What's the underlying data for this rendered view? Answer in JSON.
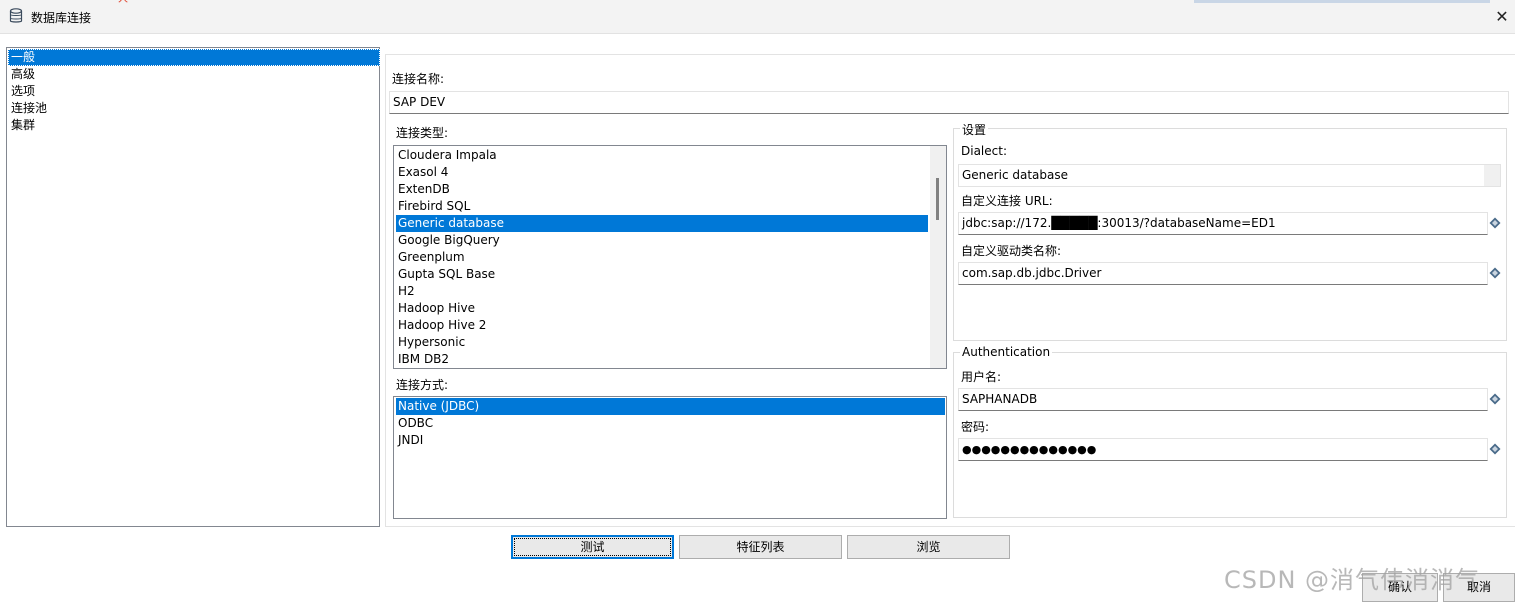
{
  "window": {
    "title": "数据库连接",
    "close_glyph": "✕",
    "red_mark": "人"
  },
  "nav": {
    "items": [
      "一般",
      "高级",
      "选项",
      "连接池",
      "集群"
    ],
    "selected": 0
  },
  "connection_name": {
    "label": "连接名称:",
    "value": "SAP DEV"
  },
  "connection_type": {
    "label": "连接类型:",
    "items": [
      "Cloudera Impala",
      "Exasol 4",
      "ExtenDB",
      "Firebird SQL",
      "Generic database",
      "Google BigQuery",
      "Greenplum",
      "Gupta SQL Base",
      "H2",
      "Hadoop Hive",
      "Hadoop Hive 2",
      "Hypersonic",
      "IBM DB2"
    ],
    "selected": 4
  },
  "access_method": {
    "label": "连接方式:",
    "items": [
      "Native (JDBC)",
      "ODBC",
      "JNDI"
    ],
    "selected": 0
  },
  "settings": {
    "legend": "设置",
    "dialect_label": "Dialect:",
    "dialect_value": "Generic database",
    "custom_url_label": "自定义连接 URL:",
    "custom_url_value": "jdbc:sap://172.█████:30013/?databaseName=ED1",
    "driver_label": "自定义驱动类名称:",
    "driver_value": "com.sap.db.jdbc.Driver"
  },
  "authentication": {
    "legend": "Authentication",
    "username_label": "用户名:",
    "username_value": "SAPHANADB",
    "password_label": "密码:",
    "password_value": "●●●●●●●●●●●●●●"
  },
  "buttons": {
    "test": "测试",
    "feature_list": "特征列表",
    "explore": "浏览",
    "ok": "确认",
    "cancel": "取消"
  },
  "watermark": "CSDN @消气伟消消气",
  "icons": {
    "window": "database-icon",
    "variable": "variable-diamond-icon"
  },
  "colors": {
    "selection": "#0078d7",
    "variable_icon": "#4a6b8a"
  }
}
